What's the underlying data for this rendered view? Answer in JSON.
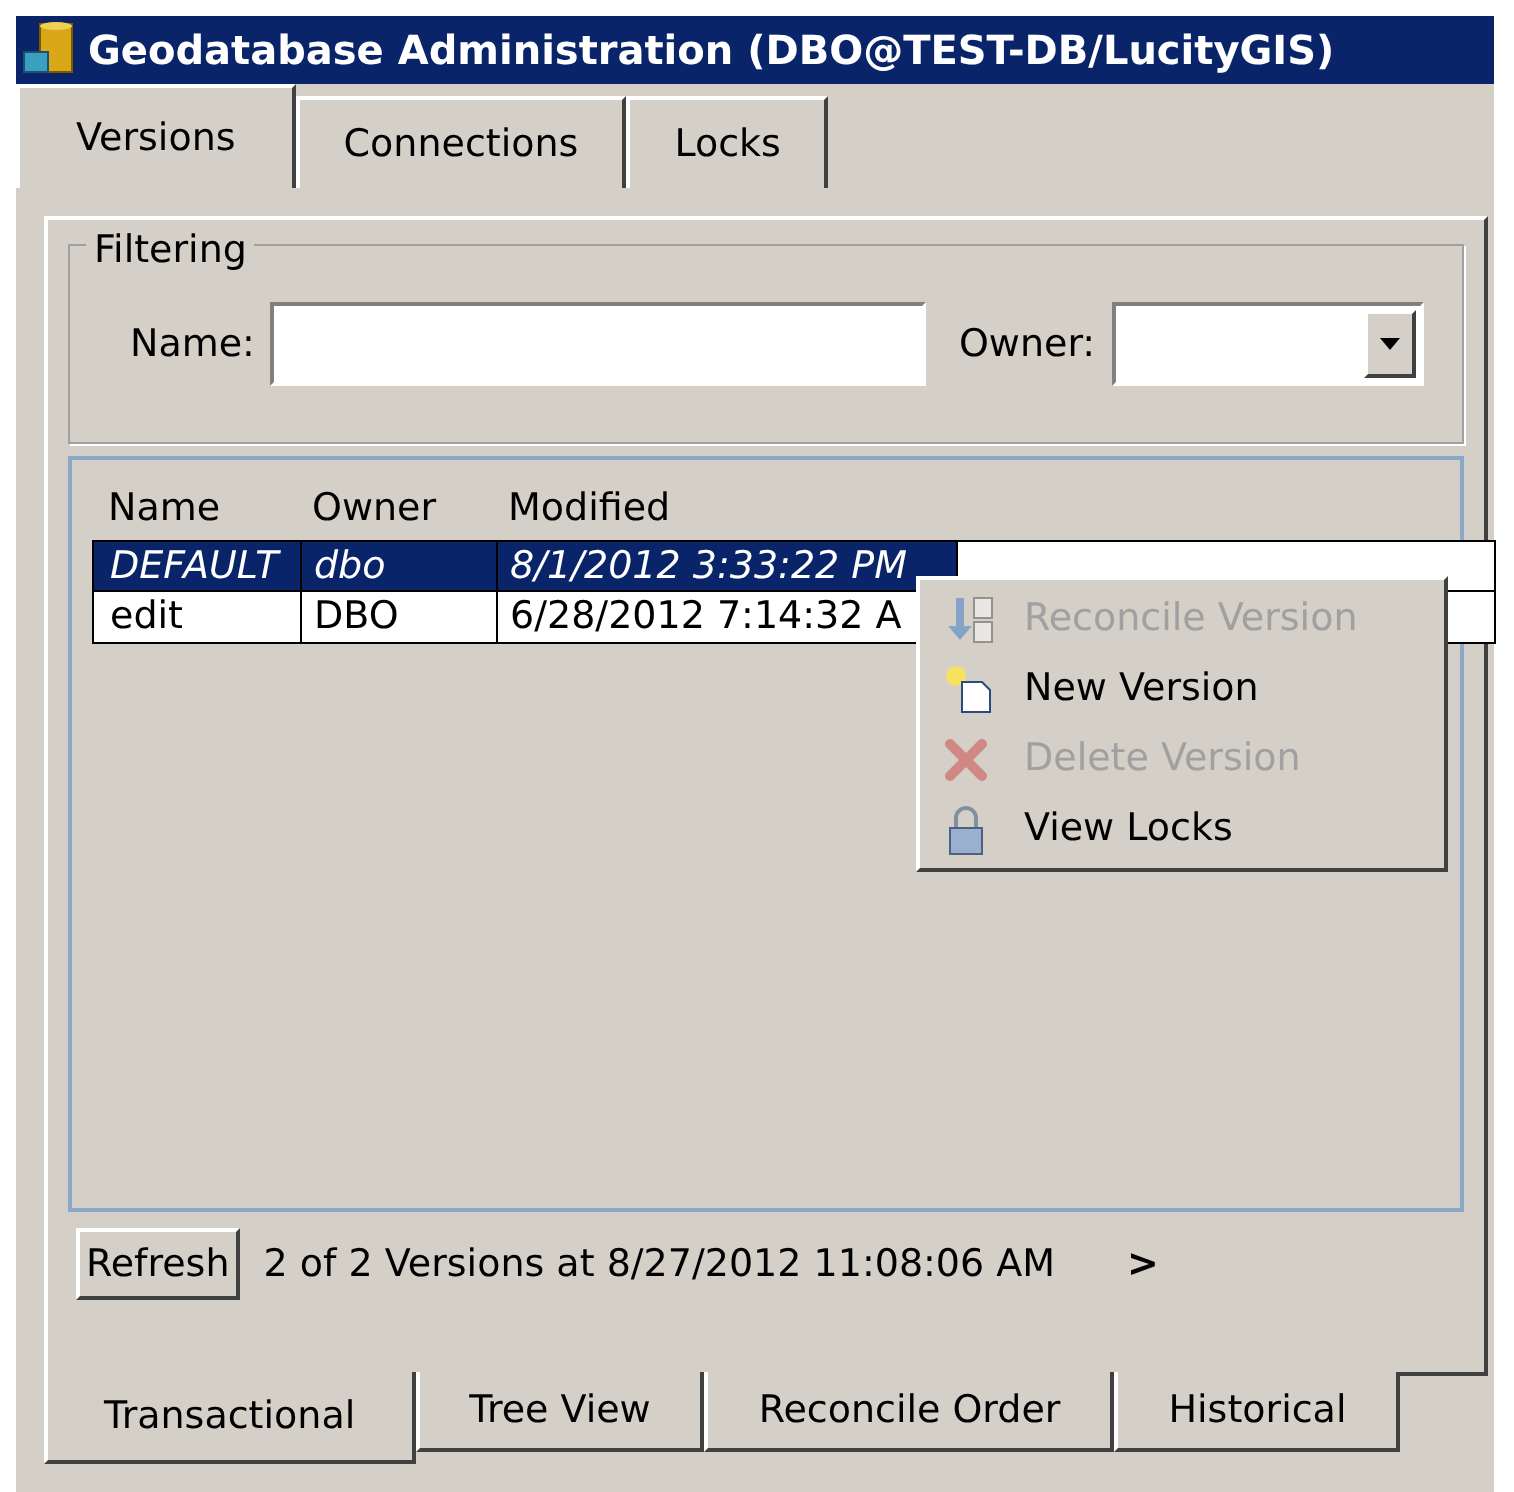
{
  "window": {
    "title": "Geodatabase Administration (DBO@TEST-DB/LucityGIS)"
  },
  "tabs": [
    {
      "label": "Versions",
      "selected": true
    },
    {
      "label": "Connections",
      "selected": false
    },
    {
      "label": "Locks",
      "selected": false
    }
  ],
  "filtering": {
    "legend": "Filtering",
    "name_label": "Name:",
    "owner_label": "Owner:"
  },
  "versions_table": {
    "columns": [
      "Name",
      "Owner",
      "Modified"
    ],
    "rows": [
      {
        "cells": [
          "DEFAULT",
          "dbo",
          "8/1/2012 3:33:22 PM"
        ],
        "selected": true
      },
      {
        "cells": [
          "edit",
          "DBO",
          "6/28/2012 7:14:32 A"
        ],
        "selected": false
      }
    ]
  },
  "context_menu": [
    {
      "label": "Reconcile Version",
      "disabled": true,
      "kind": "reconcile"
    },
    {
      "label": "New Version",
      "disabled": false,
      "kind": "new"
    },
    {
      "label": "Delete Version",
      "disabled": true,
      "kind": "delete"
    },
    {
      "label": "View Locks",
      "disabled": false,
      "kind": "locks"
    }
  ],
  "refresh_button": "Refresh",
  "status_text": "2 of 2 Versions at 8/27/2012 11:08:06 AM",
  "scroll_arrow": ">",
  "bottom_tabs": [
    {
      "label": "Transactional",
      "selected": true
    },
    {
      "label": "Tree View",
      "selected": false
    },
    {
      "label": "Reconcile Order",
      "selected": false
    },
    {
      "label": "Historical",
      "selected": false
    }
  ]
}
